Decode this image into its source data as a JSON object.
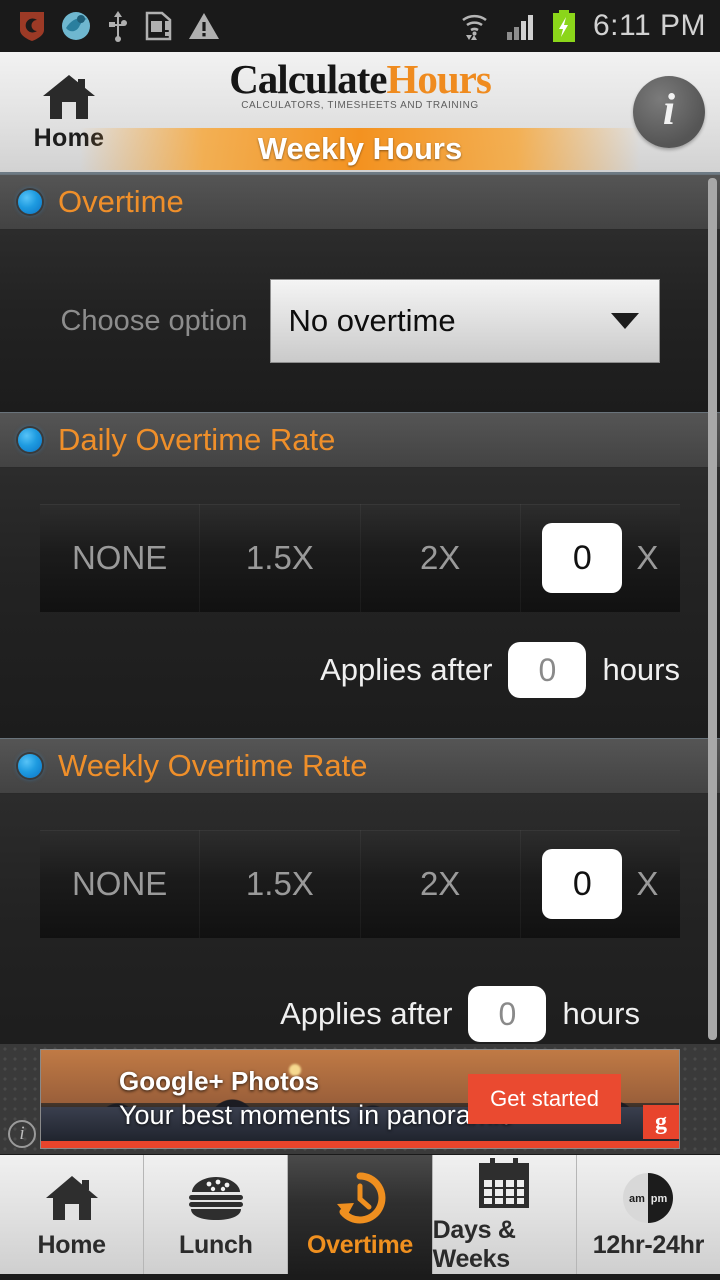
{
  "statusbar": {
    "time": "6:11 PM",
    "left_icons": [
      "shield-icon",
      "browser-icon",
      "usb-icon",
      "sim-card-warning-icon",
      "warning-triangle-icon"
    ],
    "right_icons": [
      "wifi-icon",
      "cellular-signal-icon",
      "battery-charging-icon"
    ]
  },
  "header": {
    "home_label": "Home",
    "logo_first": "Calculate",
    "logo_second": "Hours",
    "tagline": "CALCULATORS, TIMESHEETS AND TRAINING",
    "page_title": "Weekly Hours",
    "info_label": "i"
  },
  "sections": {
    "overtime": {
      "title": "Overtime",
      "choose_label": "Choose option",
      "spinner_value": "No overtime",
      "spinner_options": [
        "No overtime"
      ]
    },
    "daily": {
      "title": "Daily Overtime Rate",
      "segments": [
        "NONE",
        "1.5X",
        "2X"
      ],
      "custom_value": "0",
      "custom_suffix": "X",
      "applies_prefix": "Applies after",
      "applies_value": "0",
      "applies_suffix": "hours"
    },
    "weekly": {
      "title": "Weekly Overtime Rate",
      "segments": [
        "NONE",
        "1.5X",
        "2X"
      ],
      "custom_value": "0",
      "custom_suffix": "X",
      "applies_prefix": "Applies after",
      "applies_value": "0",
      "applies_suffix": "hours"
    }
  },
  "ad": {
    "title": "Google+ Photos",
    "subtitle": "Your best moments in panoramic",
    "cta": "Get started",
    "badge": "g",
    "info": "i"
  },
  "navbar": {
    "items": [
      {
        "label": "Home",
        "icon": "house-icon",
        "active": false
      },
      {
        "label": "Lunch",
        "icon": "hamburger-icon",
        "active": false
      },
      {
        "label": "Overtime",
        "icon": "clock-refresh-icon",
        "active": true
      },
      {
        "label": "Days & Weeks",
        "icon": "calendar-icon",
        "active": false
      },
      {
        "label": "12hr-24hr",
        "icon": "am-pm-clock-icon",
        "active": false
      }
    ]
  },
  "colors": {
    "accent_orange": "#ef8f2a",
    "radio_blue": "#1e9be0",
    "ad_red": "#e8442c"
  }
}
